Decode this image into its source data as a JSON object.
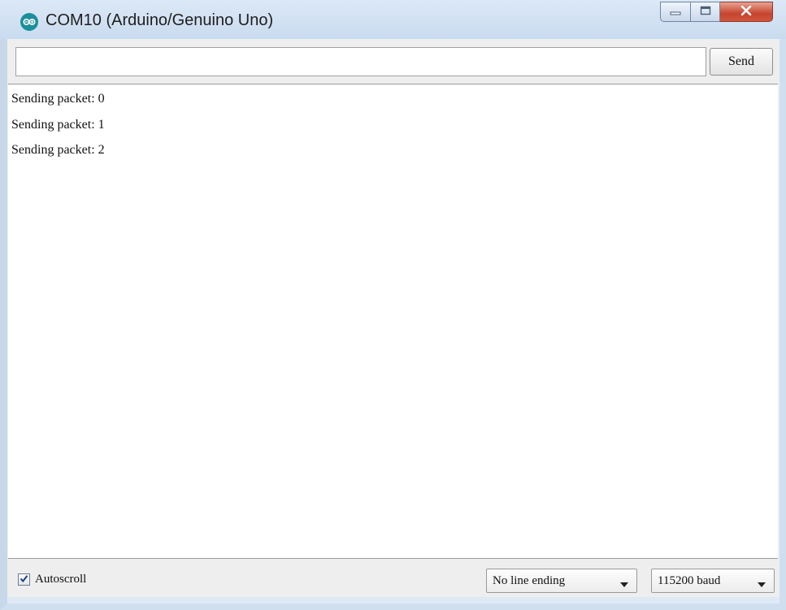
{
  "window": {
    "title": "COM10 (Arduino/Genuino Uno)",
    "app_icon": "arduino-infinity-icon",
    "controls": [
      "minimize-icon",
      "maximize-icon",
      "close-icon"
    ]
  },
  "send_bar": {
    "input_value": "",
    "send_label": "Send"
  },
  "output": {
    "lines": [
      "Sending packet: 0",
      "Sending packet: 1",
      "Sending packet: 2"
    ]
  },
  "status": {
    "autoscroll_label": "Autoscroll",
    "autoscroll_checked": true,
    "line_ending": "No line ending",
    "baud_rate": "115200 baud"
  },
  "colors": {
    "titlebar": "#c9dbef",
    "close_button": "#c6442d",
    "arduino_teal": "#1b8f9c"
  }
}
